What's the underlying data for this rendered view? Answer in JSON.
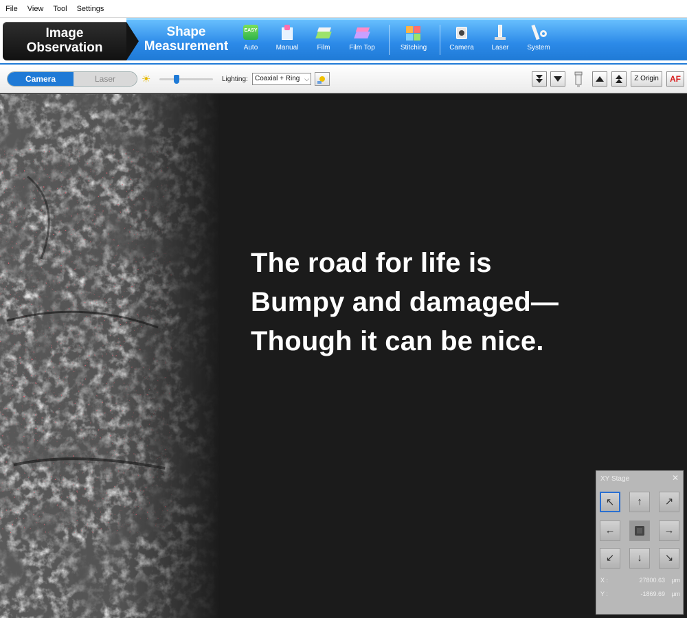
{
  "menu": [
    "File",
    "View",
    "Tool",
    "Settings"
  ],
  "tabs": {
    "image_observation_line1": "Image",
    "image_observation_line2": "Observation",
    "shape_measurement_line1": "Shape",
    "shape_measurement_line2": "Measurement"
  },
  "ribbon_buttons": [
    {
      "label": "Auto",
      "icon": "easy-auto-icon",
      "badge": "EASY"
    },
    {
      "label": "Manual",
      "icon": "manual-icon"
    },
    {
      "label": "Film",
      "icon": "film-icon"
    },
    {
      "label": "Film Top",
      "icon": "film-top-icon"
    },
    {
      "label": "Stitching",
      "icon": "stitching-icon"
    },
    {
      "label": "Camera",
      "icon": "camera-icon"
    },
    {
      "label": "Laser",
      "icon": "laser-icon"
    },
    {
      "label": "System",
      "icon": "system-icon"
    }
  ],
  "toolbar": {
    "mode_camera": "Camera",
    "mode_laser": "Laser",
    "brightness_level": 0.3,
    "lighting_label": "Lighting:",
    "lighting_value": "Coaxial + Ring",
    "z_origin": "Z Origin",
    "af": "AF"
  },
  "caption": {
    "line1": "The road for life is",
    "line2": "Bumpy and damaged—",
    "line3": "Though it can be nice."
  },
  "xy_stage": {
    "title": "XY Stage",
    "x_label": "X :",
    "x_value": "27800.63",
    "y_label": "Y :",
    "y_value": "-1869.69",
    "unit": "µm"
  },
  "colors": {
    "accent_blue": "#1f7ad6",
    "ribbon_light": "#6cc3ff",
    "af_red": "#d81c1c"
  }
}
